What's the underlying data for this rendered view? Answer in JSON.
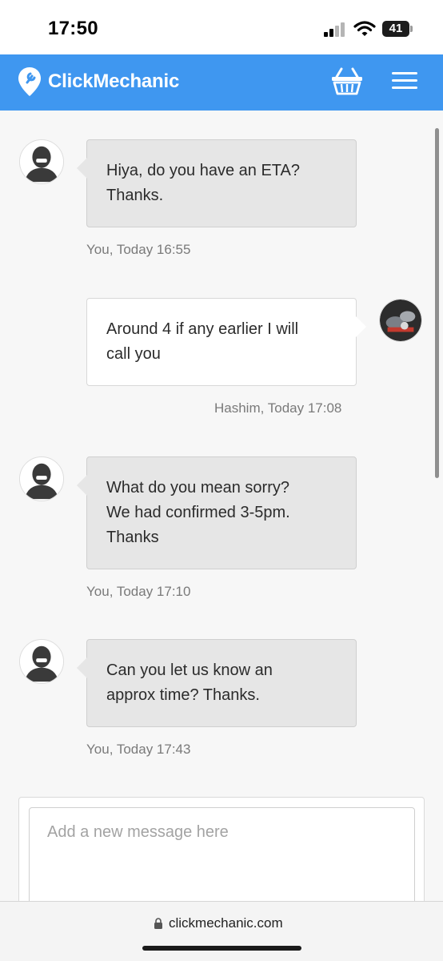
{
  "status_bar": {
    "time": "17:50",
    "battery": "41"
  },
  "header": {
    "brand": "ClickMechanic",
    "brand_color": "#3f97f0",
    "basket_icon": "basket-icon",
    "menu_icon": "hamburger-menu-icon"
  },
  "messages": [
    {
      "author": "You",
      "side": "left",
      "lines": [
        "Hiya, do you have an ETA?",
        "Thanks."
      ],
      "meta": "You, Today 16:55"
    },
    {
      "author": "Hashim",
      "side": "right",
      "lines": [
        "Around 4 if any earlier I will",
        "call you"
      ],
      "meta": "Hashim, Today 17:08"
    },
    {
      "author": "You",
      "side": "left",
      "lines": [
        "What do you mean sorry?",
        "We had confirmed 3-5pm.",
        "Thanks"
      ],
      "meta": "You, Today 17:10"
    },
    {
      "author": "You",
      "side": "left",
      "lines": [
        "Can you let us know an",
        "approx time? Thanks."
      ],
      "meta": "You, Today 17:43"
    }
  ],
  "composer": {
    "placeholder": "Add a new message here",
    "value": ""
  },
  "browser": {
    "url": "clickmechanic.com"
  }
}
